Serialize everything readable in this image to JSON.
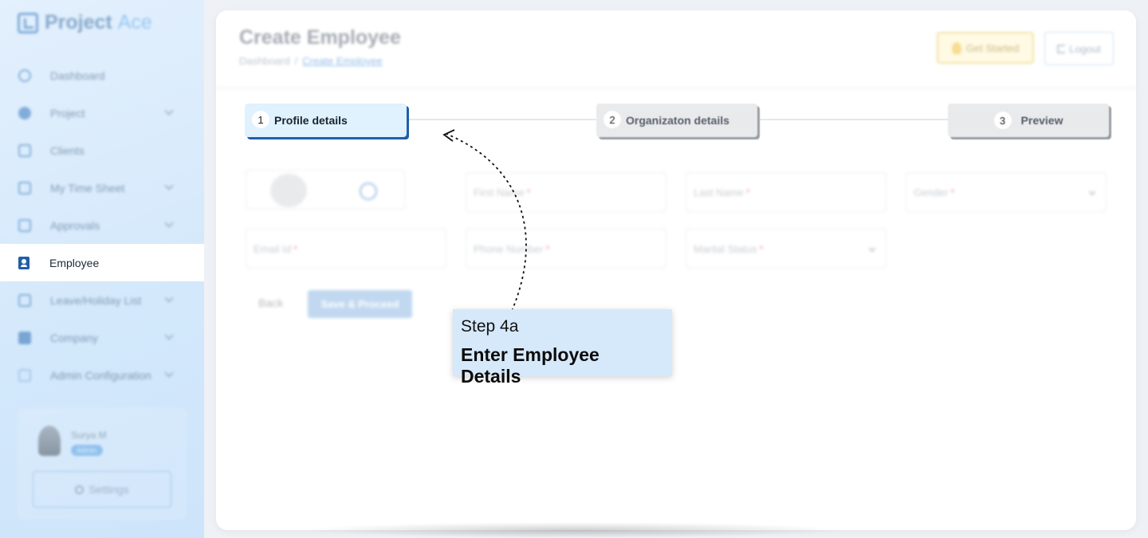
{
  "app": {
    "name_main": "Project",
    "name_accent": "Ace"
  },
  "sidebar": {
    "items": [
      {
        "label": "Dashboard",
        "icon": "dashboard-icon",
        "has_chevron": false
      },
      {
        "label": "Project",
        "icon": "project-icon",
        "has_chevron": true
      },
      {
        "label": "Clients",
        "icon": "clients-icon",
        "has_chevron": false
      },
      {
        "label": "My Time Sheet",
        "icon": "timesheet-icon",
        "has_chevron": true
      },
      {
        "label": "Approvals",
        "icon": "approvals-icon",
        "has_chevron": true
      },
      {
        "label": "Employee",
        "icon": "employee-icon",
        "has_chevron": false,
        "active": true
      },
      {
        "label": "Leave/Holiday List",
        "icon": "leave-icon",
        "has_chevron": true
      },
      {
        "label": "Company",
        "icon": "company-icon",
        "has_chevron": true
      },
      {
        "label": "Admin Configuration",
        "icon": "admin-icon",
        "has_chevron": true
      }
    ],
    "user": {
      "name": "Surya M",
      "role": "Admin",
      "settings_label": "Settings"
    }
  },
  "header": {
    "title": "Create Employee",
    "breadcrumb": [
      "Dashboard",
      "/",
      "Create Employee"
    ],
    "get_started_label": "Get Started",
    "logout_label": "Logout"
  },
  "stepper": {
    "steps": [
      {
        "num": "1",
        "label": "Profile details"
      },
      {
        "num": "2",
        "label": "Organizaton details"
      },
      {
        "num": "3",
        "label": "Preview"
      }
    ]
  },
  "form": {
    "first_name": "First Name",
    "last_name": "Last Name",
    "gender": "Gender",
    "email": "Email Id",
    "phone": "Phone Number",
    "marital_status": "Marital Status",
    "required_mark": "*",
    "back_label": "Back",
    "save_label": "Save & Proceed"
  },
  "callout": {
    "step": "Step 4a",
    "title": "Enter Employee Details"
  },
  "colors": {
    "accent": "#1f5fa8",
    "callout_bg": "#d6e9fb",
    "sidebar_bg": "#d3e8fb"
  }
}
